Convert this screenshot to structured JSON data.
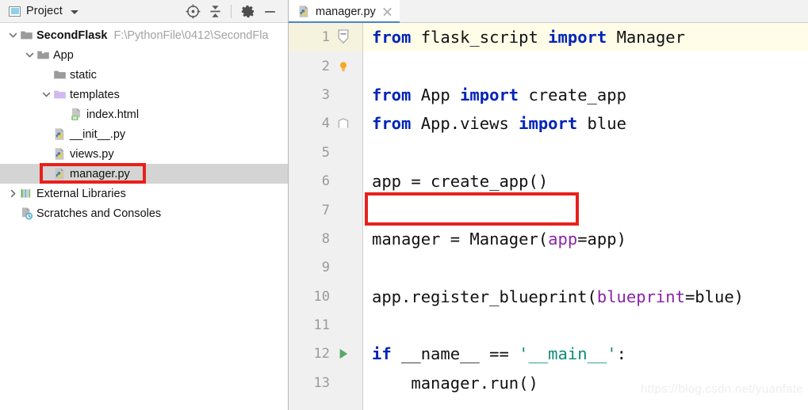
{
  "project_panel": {
    "title": "Project",
    "title_icon": "project-window-icon",
    "dropdown_icon": "chevron-down-icon",
    "toolbar_buttons": [
      {
        "name": "locate-icon",
        "label": "Select Opened File"
      },
      {
        "name": "collapse-all-icon",
        "label": "Collapse All"
      },
      {
        "name": "gear-icon",
        "label": "Settings"
      },
      {
        "name": "minimize-icon",
        "label": "Hide"
      }
    ],
    "tree": [
      {
        "label": "SecondFlask",
        "path": "F:\\PythonFile\\0412\\SecondFla",
        "icon": "folder-module-icon",
        "arrow": "expanded",
        "indent": 0,
        "bold": true,
        "selected": false
      },
      {
        "label": "App",
        "path": "",
        "icon": "folder-source-icon",
        "arrow": "expanded",
        "indent": 1,
        "bold": false,
        "selected": false
      },
      {
        "label": "static",
        "path": "",
        "icon": "folder-icon",
        "arrow": "none",
        "indent": 2,
        "bold": false,
        "selected": false
      },
      {
        "label": "templates",
        "path": "",
        "icon": "folder-templates-icon",
        "arrow": "expanded",
        "indent": 2,
        "bold": false,
        "selected": false
      },
      {
        "label": "index.html",
        "path": "",
        "icon": "html-file-icon",
        "arrow": "none",
        "indent": 3,
        "bold": false,
        "selected": false
      },
      {
        "label": "__init__.py",
        "path": "",
        "icon": "python-file-icon",
        "arrow": "none",
        "indent": 2,
        "bold": false,
        "selected": false
      },
      {
        "label": "views.py",
        "path": "",
        "icon": "python-file-icon",
        "arrow": "none",
        "indent": 2,
        "bold": false,
        "selected": false
      },
      {
        "label": "manager.py",
        "path": "",
        "icon": "python-file-icon",
        "arrow": "none",
        "indent": 2,
        "bold": false,
        "selected": true
      },
      {
        "label": "External Libraries",
        "path": "",
        "icon": "external-libraries-icon",
        "arrow": "collapsed",
        "indent": 0,
        "bold": false,
        "selected": false
      },
      {
        "label": "Scratches and Consoles",
        "path": "",
        "icon": "scratches-icon",
        "arrow": "none",
        "indent": 0,
        "bold": false,
        "selected": false
      }
    ]
  },
  "editor": {
    "tab": {
      "label": "manager.py",
      "icon": "python-file-icon",
      "close_icon": "close-icon",
      "active": true
    },
    "lines": [
      {
        "number": "1",
        "caret": true,
        "gutter_mark": "fold-collapse-icon",
        "tokens": [
          {
            "t": "from",
            "c": "kw"
          },
          {
            "t": " flask_script ",
            "c": "plain"
          },
          {
            "t": "import",
            "c": "kw"
          },
          {
            "t": " Manager",
            "c": "plain"
          }
        ]
      },
      {
        "number": "2",
        "caret": false,
        "gutter_mark": "lightbulb-icon",
        "tokens": []
      },
      {
        "number": "3",
        "caret": false,
        "gutter_mark": "",
        "tokens": [
          {
            "t": "from",
            "c": "kw"
          },
          {
            "t": " App ",
            "c": "plain"
          },
          {
            "t": "import",
            "c": "kw"
          },
          {
            "t": " create_app",
            "c": "plain"
          }
        ]
      },
      {
        "number": "4",
        "caret": false,
        "gutter_mark": "fold-end-icon",
        "tokens": [
          {
            "t": "from",
            "c": "kw"
          },
          {
            "t": " App.views ",
            "c": "plain"
          },
          {
            "t": "import",
            "c": "kw"
          },
          {
            "t": " blue",
            "c": "plain"
          }
        ]
      },
      {
        "number": "5",
        "caret": false,
        "gutter_mark": "",
        "tokens": []
      },
      {
        "number": "6",
        "caret": false,
        "gutter_mark": "",
        "tokens": [
          {
            "t": "app = create_app()",
            "c": "plain"
          }
        ]
      },
      {
        "number": "7",
        "caret": false,
        "gutter_mark": "",
        "tokens": []
      },
      {
        "number": "8",
        "caret": false,
        "gutter_mark": "",
        "tokens": [
          {
            "t": "manager = Manager(",
            "c": "plain"
          },
          {
            "t": "app",
            "c": "kwarg"
          },
          {
            "t": "=app)",
            "c": "plain"
          }
        ]
      },
      {
        "number": "9",
        "caret": false,
        "gutter_mark": "",
        "tokens": []
      },
      {
        "number": "10",
        "caret": false,
        "gutter_mark": "",
        "tokens": [
          {
            "t": "app.register_blueprint(",
            "c": "plain"
          },
          {
            "t": "blueprint",
            "c": "kwarg"
          },
          {
            "t": "=blue)",
            "c": "plain"
          }
        ]
      },
      {
        "number": "11",
        "caret": false,
        "gutter_mark": "",
        "tokens": []
      },
      {
        "number": "12",
        "caret": false,
        "gutter_mark": "run-icon",
        "tokens": [
          {
            "t": "if",
            "c": "kw"
          },
          {
            "t": " __name__ == ",
            "c": "plain"
          },
          {
            "t": "'__main__'",
            "c": "str"
          },
          {
            "t": ":",
            "c": "plain"
          }
        ]
      },
      {
        "number": "13",
        "caret": false,
        "gutter_mark": "",
        "tokens": [
          {
            "t": "    manager.run()",
            "c": "plain"
          }
        ]
      }
    ]
  },
  "annotations": [
    {
      "name": "manager-py-highlight-box",
      "color": "#e8201b",
      "target": "manager.py"
    },
    {
      "name": "create-app-highlight-box",
      "color": "#e8201b",
      "target": "app = create_app()"
    }
  ],
  "watermark": "https://blog.csdn.net/yuanfate",
  "colors": {
    "keyword": "#0024b8",
    "string": "#0b8b78",
    "kwarg": "#8a24a8",
    "annotation_red": "#e8201b",
    "tab_active_underline": "#4a86c8",
    "caret_line": "#fffce8",
    "selection_gray": "#d4d4d4"
  }
}
